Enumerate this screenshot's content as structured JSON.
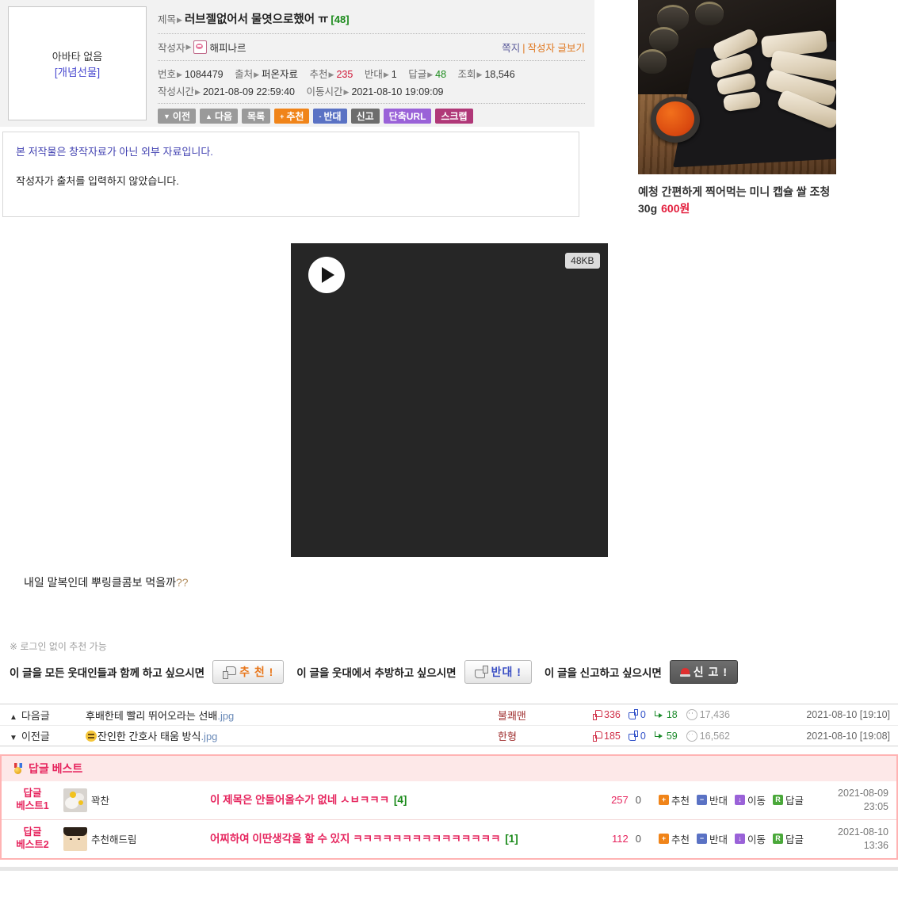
{
  "post": {
    "avatar": {
      "none_label": "아바타 없음",
      "gift_label": "[개념선물]"
    },
    "title_label": "제목",
    "title": "러브젤없어서 물엿으로했어 ㅠ",
    "comment_count_label": "[48]",
    "author_label": "작성자",
    "author_name": "해피나르",
    "message_link": "쪽지",
    "author_posts_link": "작성자 글보기",
    "meta": {
      "number_label": "번호",
      "number": "1084479",
      "source_label": "출처",
      "source": "퍼온자료",
      "up_label": "추천",
      "up": "235",
      "down_label": "반대",
      "down": "1",
      "reply_label": "답글",
      "reply": "48",
      "views_label": "조회",
      "views": "18,546",
      "written_label": "작성시간",
      "written": "2021-08-09 22:59:40",
      "moved_label": "이동시간",
      "moved": "2021-08-10 19:09:09"
    },
    "buttons": [
      {
        "label": "이전",
        "prefix": "▼",
        "style": "btn-gray"
      },
      {
        "label": "다음",
        "prefix": "▲",
        "style": "btn-gray"
      },
      {
        "label": "목록",
        "prefix": "",
        "style": "btn-gray"
      },
      {
        "label": "추천",
        "prefix": "+",
        "style": "btn-orange"
      },
      {
        "label": "반대",
        "prefix": "-",
        "style": "btn-blue"
      },
      {
        "label": "신고",
        "prefix": "",
        "style": "btn-dgray"
      },
      {
        "label": "단축URL",
        "prefix": "",
        "style": "btn-purple"
      },
      {
        "label": "스크랩",
        "prefix": "",
        "style": "btn-magenta"
      }
    ],
    "notice_line1": "본 저작물은 창작자료가 아닌 외부 자료입니다.",
    "notice_line2": "작성자가 출처를 입력하지 않았습니다.",
    "video_size_badge": "48KB",
    "body_text": "내일 말복인데 뿌링클콤보 먹을까",
    "body_text_mark": "??"
  },
  "ad": {
    "caption_line1": "예청 간편하게 찍어먹는 미니 캡슐",
    "caption_line2": "쌀 조청 30g",
    "price": "600원"
  },
  "recommend": {
    "note": "※ 로그인 없이 추천 가능",
    "up_text": "이 글을 모든 웃대인들과 함께 하고 싶으시면",
    "up_button": "추 천 !",
    "down_text": "이 글을 웃대에서 추방하고 싶으시면",
    "down_button": "반대 !",
    "report_text": "이 글을 신고하고 싶으시면",
    "report_button": "신 고 !"
  },
  "nav": {
    "rows": [
      {
        "dir": "다음글",
        "tri": "▲",
        "subject": "후배한테 빨리 뛰어오라는 선배",
        "ext": ".jpg",
        "writer": "불쾌맨",
        "up": "336",
        "down": "0",
        "comments": "18",
        "views": "17,436",
        "date": "2021-08-10 [19:10]"
      },
      {
        "dir": "이전글",
        "tri": "▼",
        "subject": "잔인한 간호사 태움 방식",
        "ext": ".jpg",
        "writer": "한형",
        "up": "185",
        "down": "0",
        "comments": "59",
        "views": "16,562",
        "date": "2021-08-10 [19:08]"
      }
    ]
  },
  "best": {
    "header": "답글 베스트",
    "actions": [
      {
        "label": "추천",
        "glyph": "+",
        "style": "sq-o"
      },
      {
        "label": "반대",
        "glyph": "−",
        "style": "sq-b"
      },
      {
        "label": "이동",
        "glyph": "↓",
        "style": "sq-p"
      },
      {
        "label": "답글",
        "glyph": "R",
        "style": "sq-g"
      }
    ],
    "comments": [
      {
        "rank_line1": "답글",
        "rank_line2": "베스트1",
        "user": "꽉찬",
        "text": "이 제목은 안들어올수가 없네 ㅅㅂㅋㅋㅋ",
        "replies": "[4]",
        "up": "257",
        "down": "0",
        "date_line1": "2021-08-09",
        "date_line2": "23:05"
      },
      {
        "rank_line1": "답글",
        "rank_line2": "베스트2",
        "user": "추천해드림",
        "text": "어찌하여 이딴생각을 할 수 있지 ㅋㅋㅋㅋㅋㅋㅋㅋㅋㅋㅋㅋㅋㅋㅋ",
        "replies": "[1]",
        "up": "112",
        "down": "0",
        "date_line1": "2021-08-10",
        "date_line2": "13:36"
      }
    ]
  }
}
